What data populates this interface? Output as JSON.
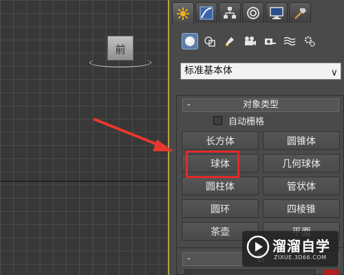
{
  "viewport": {
    "viewcube_label": "前"
  },
  "panel": {
    "tabs": [
      "create-tab",
      "modify-tab",
      "hierarchy-tab",
      "motion-tab",
      "display-tab",
      "utilities-tab"
    ],
    "subtabs": [
      "geometry-icon",
      "shapes-icon",
      "lights-icon",
      "cameras-icon",
      "helpers-icon",
      "space-warps-icon",
      "systems-icon"
    ],
    "category": {
      "selected": "标准基本体",
      "chevron": "∨"
    },
    "object_type": {
      "minus": "-",
      "title": "对象类型",
      "autogrid_label": "自动栅格",
      "buttons": [
        "长方体",
        "圆锥体",
        "球体",
        "几何球体",
        "圆柱体",
        "管状体",
        "圆环",
        "四棱锥",
        "茶壶",
        "平面"
      ],
      "highlighted": "球体"
    },
    "name_color": {
      "minus": "-",
      "title": "名"
    }
  },
  "watermark": {
    "brand": "溜溜自学",
    "url": "ZIXUE.3D66.COM"
  },
  "colors": {
    "highlight": "#e02a2a",
    "arrow": "#e8382e",
    "active_tab": "#5e7ea8"
  }
}
